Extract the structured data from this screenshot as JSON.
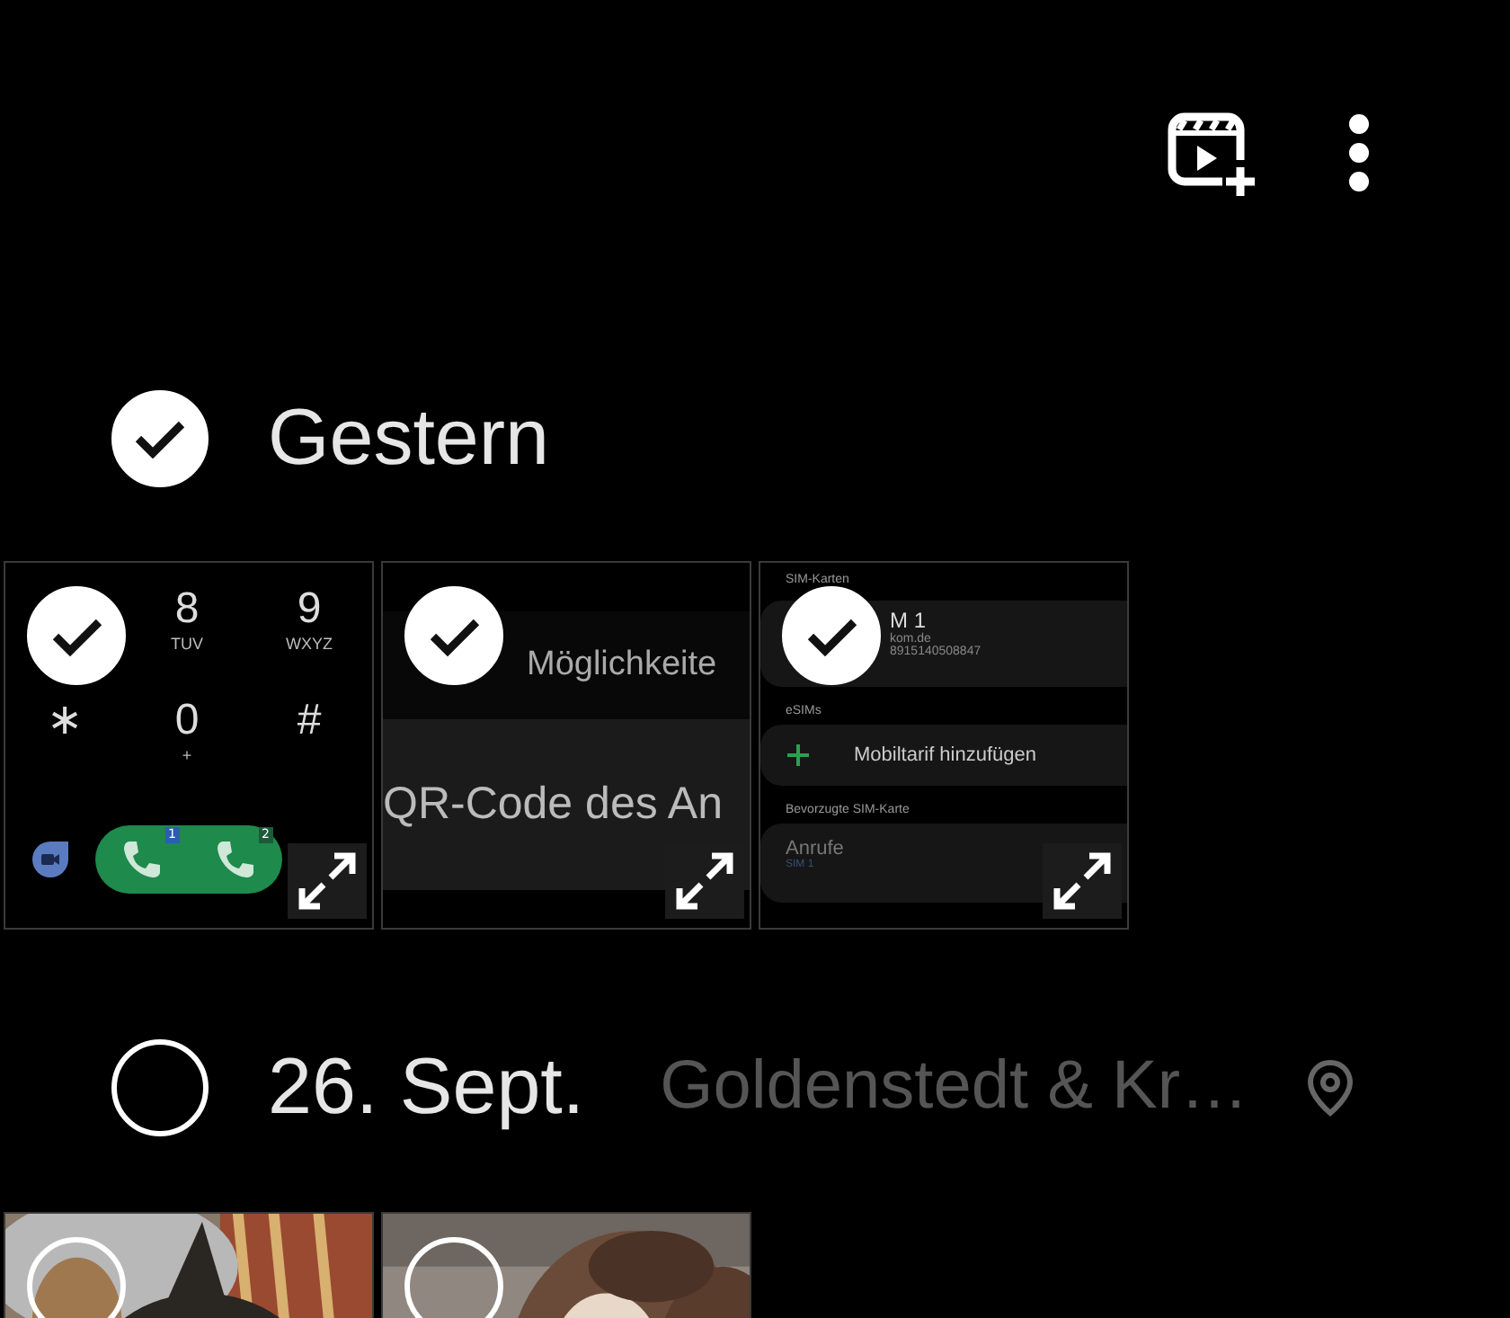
{
  "toolbar": {
    "buttons": [
      {
        "kind": "new-video"
      },
      {
        "kind": "more"
      }
    ]
  },
  "groups": [
    {
      "title": "Gestern",
      "selected": true,
      "items": [
        {
          "kind": "dialpad",
          "selected": true,
          "keys": [
            {
              "digit": "8",
              "letters": "TUV"
            },
            {
              "digit": "9",
              "letters": "WXYZ"
            },
            {
              "digit": "∗"
            },
            {
              "digit": "0",
              "letters": "+"
            },
            {
              "digit": "#"
            }
          ],
          "sim_badges": [
            "1",
            "2"
          ]
        },
        {
          "kind": "text-screen",
          "selected": true,
          "lines": [
            "Möglichkeite",
            "QR-Code des An"
          ]
        },
        {
          "kind": "sim-settings",
          "selected": true,
          "header": "SIM-Karten",
          "sim": {
            "name": "M 1",
            "provider": "kom.de",
            "number": "8915140508847"
          },
          "esim_label": "eSIMs",
          "add_label": "Mobiltarif hinzufügen",
          "preferred_label": "Bevorzugte SIM-Karte",
          "preferred": {
            "title": "Anrufe",
            "value": "SIM 1"
          }
        }
      ]
    },
    {
      "title": "26. Sept.",
      "selected": false,
      "location": "Goldenstedt & Kr…"
    }
  ]
}
